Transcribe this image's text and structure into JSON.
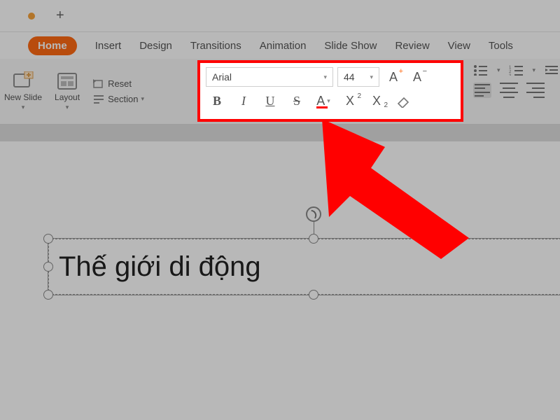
{
  "titlebar": {
    "new_tab_glyph": "+"
  },
  "ribbon": {
    "tabs": [
      "Home",
      "Insert",
      "Design",
      "Transitions",
      "Animation",
      "Slide Show",
      "Review",
      "View",
      "Tools"
    ],
    "active_tab": "Home",
    "slide_group": {
      "new_slide": "New Slide",
      "layout": "Layout",
      "reset": "Reset",
      "section": "Section"
    },
    "font": {
      "name": "Arial",
      "size": "44",
      "buttons": {
        "grow": "A",
        "shrink": "A",
        "bold": "B",
        "italic": "I",
        "underline": "U",
        "strike": "S",
        "color": "A",
        "superscript": "X",
        "subscript": "X",
        "clear": "◇"
      }
    }
  },
  "slide": {
    "title_text": "Thế giới di động"
  },
  "colors": {
    "accent": "#ff6a13",
    "highlight_border": "#ff0000",
    "annotation": "#ff0000"
  }
}
